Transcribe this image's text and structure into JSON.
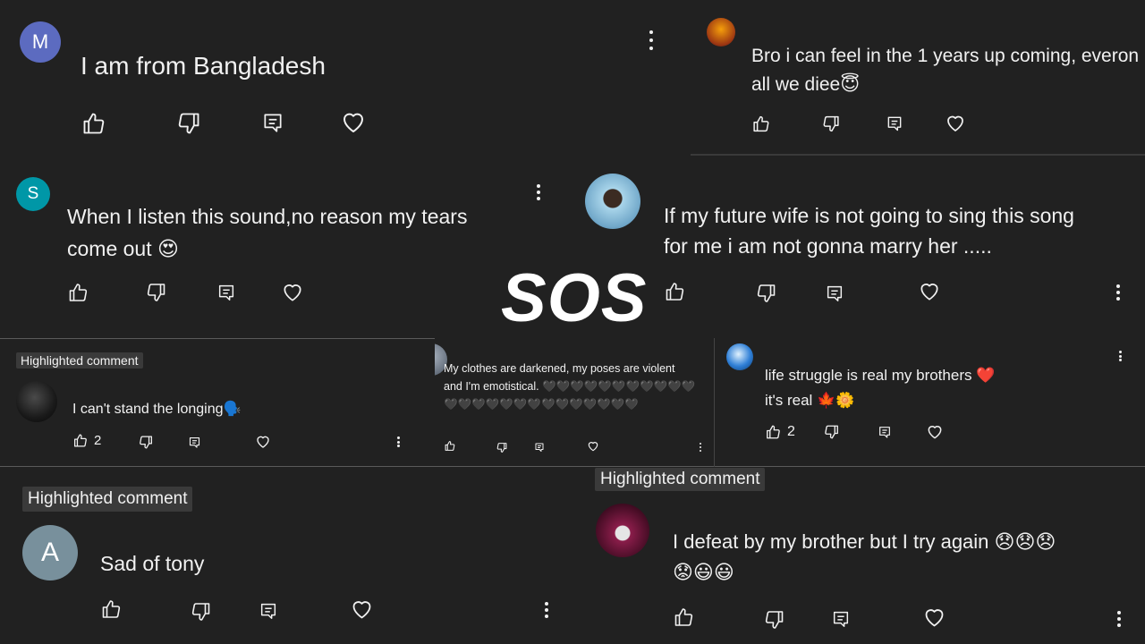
{
  "overlay_title": "SOS",
  "highlight_label": "Highlighted comment",
  "comments": [
    {
      "id": "c1",
      "avatar_letter": "M",
      "avatar_color": "#5c6bc0",
      "text": "I am from Bangladesh",
      "likes": ""
    },
    {
      "id": "c2",
      "avatar_letter": "",
      "avatar_color": "#c2410c",
      "text": "Bro i can feel in the 1 years up coming, everon\nall we diee😇",
      "likes": ""
    },
    {
      "id": "c3",
      "avatar_letter": "S",
      "avatar_color": "#0097a7",
      "text": "When I listen this sound,no reason my tears\ncome out 😍",
      "likes": ""
    },
    {
      "id": "c4",
      "avatar_letter": "",
      "avatar_color": "#7fb2d0",
      "text": "If my future wife is not going to sing this song\nfor me i am not gonna marry her .....",
      "likes": ""
    },
    {
      "id": "c5",
      "avatar_letter": "",
      "avatar_color": "#2e2e2e",
      "text": "I can't stand the longing🗣️",
      "likes": "2"
    },
    {
      "id": "c6",
      "avatar_letter": "",
      "avatar_color": "#6b7684",
      "text": "My clothes are darkened, my poses are violent\nand I'm emotistical. 🖤🖤🖤🖤🖤🖤🖤🖤🖤🖤🖤🖤🖤🖤🖤🖤🖤🖤🖤🖤🖤🖤🖤🖤🖤",
      "likes": ""
    },
    {
      "id": "c7",
      "avatar_letter": "",
      "avatar_color": "#2f7fd6",
      "text": "life struggle is real my brothers ❤️\nit's real 🍁🌼",
      "likes": "2"
    },
    {
      "id": "c8",
      "avatar_letter": "A",
      "avatar_color": "#78909c",
      "text": "Sad of tony",
      "likes": ""
    },
    {
      "id": "c9",
      "avatar_letter": "",
      "avatar_color": "#8a1d4a",
      "text": "I defeat by my brother but I try again 😞😞😞\n😟😃😃",
      "likes": ""
    }
  ],
  "icons": {
    "like": "thumbs-up-icon",
    "dislike": "thumbs-down-icon",
    "reply": "reply-comment-icon",
    "heart": "heart-icon",
    "more": "more-vertical-icon"
  },
  "colors": {
    "background": "#212121",
    "text": "#f1f1f1",
    "badge": "#3a3a3a"
  }
}
